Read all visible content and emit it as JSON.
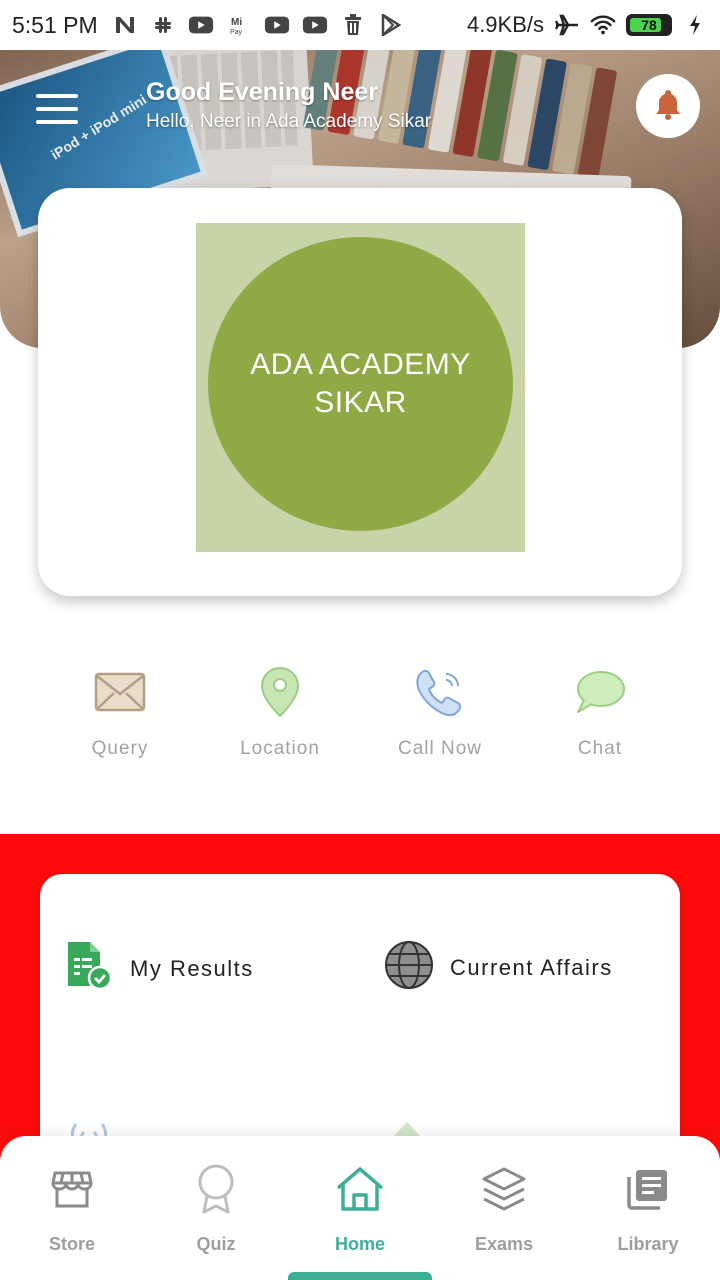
{
  "status_bar": {
    "time": "5:51 PM",
    "network_speed": "4.9KB/s",
    "battery_level": "78",
    "icons": [
      "n-notification-icon",
      "slack-icon",
      "youtube-icon",
      "mi-pay-icon",
      "youtube-icon",
      "youtube-icon",
      "trash-icon",
      "play-store-icon",
      "airplane-icon",
      "wifi-icon",
      "battery-icon",
      "charging-icon"
    ]
  },
  "header": {
    "greeting": "Good Evening Neer",
    "subtitle": "Hello, Neer in Ada Academy Sikar",
    "menu_icon": "hamburger-menu-icon",
    "notification_icon": "bell-icon"
  },
  "logo": {
    "line1": "ADA ACADEMY",
    "line2": "SIKAR",
    "colors": {
      "background": "#c8d4a8",
      "circle": "#8faa45"
    }
  },
  "quick_actions": [
    {
      "label": "Query",
      "icon": "envelope-icon"
    },
    {
      "label": "Location",
      "icon": "map-pin-icon"
    },
    {
      "label": "Call Now",
      "icon": "phone-icon"
    },
    {
      "label": "Chat",
      "icon": "chat-bubble-icon"
    }
  ],
  "features": [
    {
      "label": "My Results",
      "icon": "results-document-icon"
    },
    {
      "label": "Current Affairs",
      "icon": "globe-icon"
    }
  ],
  "section_color": "#fe0c0c",
  "bottom_nav": {
    "active": "Home",
    "accent": "#3daf96",
    "items": [
      {
        "label": "Store",
        "icon": "store-icon"
      },
      {
        "label": "Quiz",
        "icon": "award-icon"
      },
      {
        "label": "Home",
        "icon": "home-icon"
      },
      {
        "label": "Exams",
        "icon": "layers-icon"
      },
      {
        "label": "Library",
        "icon": "library-icon"
      }
    ]
  }
}
